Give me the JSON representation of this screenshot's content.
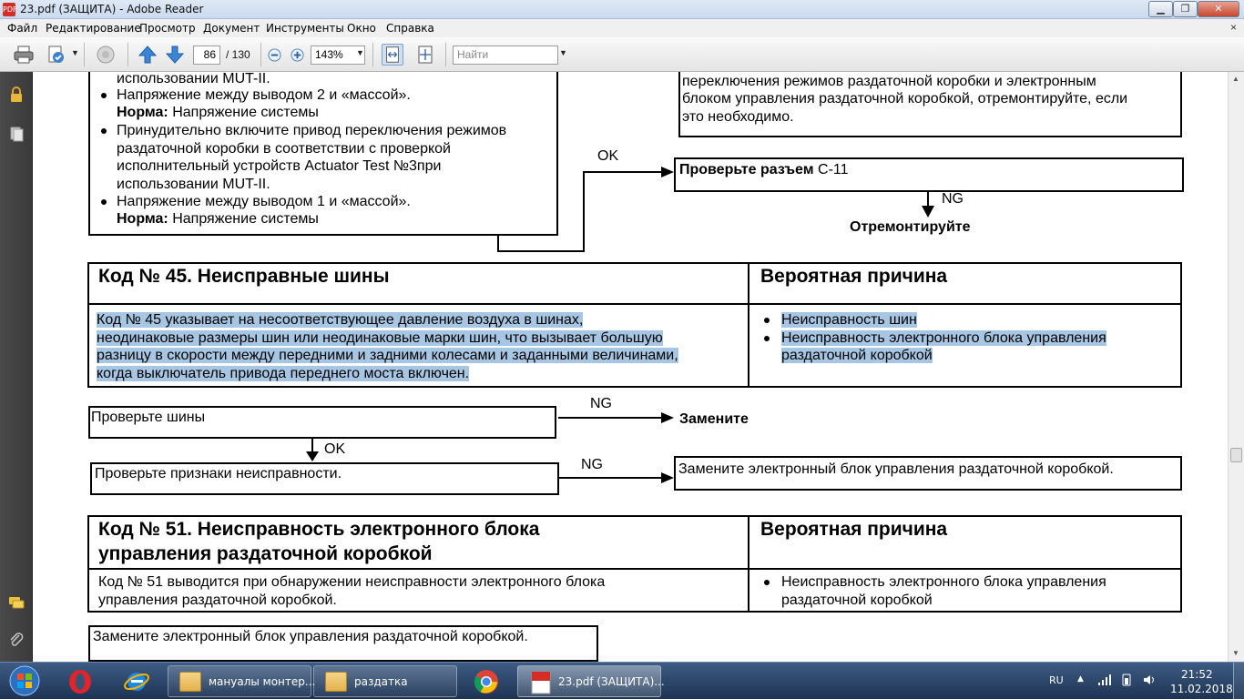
{
  "window": {
    "title": "23.pdf (ЗАЩИТА) - Adobe Reader",
    "app_icon_text": "PDF"
  },
  "menu": [
    "Файл",
    "Редактирование",
    "Просмотр",
    "Документ",
    "Инструменты",
    "Окно",
    "Справка"
  ],
  "menu_close": "×",
  "toolbar": {
    "page_current": "86",
    "page_total": "/ 130",
    "zoom": "143%",
    "find_placeholder": "Найти"
  },
  "document": {
    "top_left_box": {
      "line0": "использовании MUT-II.",
      "bullet1": "Напряжение между выводом 2 и «массой».",
      "norm1_label": "Норма:",
      "norm1_value": " Напряжение системы",
      "bullet2_l1": "Принудительно включите привод переключения режимов",
      "bullet2_l2": "раздаточной коробки в соответствии с проверкой",
      "bullet2_l3": "исполнительный устройств Actuator Test №3при",
      "bullet2_l4": "использовании MUT-II.",
      "bullet3": "Напряжение между выводом 1 и «массой».",
      "norm3_label": "Норма:",
      "norm3_value": " Напряжение системы"
    },
    "top_right_box": {
      "l1": "переключения режимов раздаточной коробки и электронным",
      "l2": "блоком управления раздаточной коробкой, отремонтируйте, если",
      "l3": "это необходимо."
    },
    "ok_label_1": "OK",
    "check_c11_bold": "Проверьте разъем ",
    "check_c11_rest": "С-11",
    "ng_label_1": "NG",
    "repair": "Отремонтируйте",
    "code45": {
      "title": "Код № 45. Неисправные шины",
      "cause_title": "Вероятная причина",
      "desc_l1": "Код № 45 указывает на несоответствующее давление воздуха в шинах,",
      "desc_l2": "неодинаковые размеры шин или неодинаковые марки шин, что вызывает большую",
      "desc_l3": "разницу в скорости между передними и задними колесами и заданными величинами,",
      "desc_l4": "когда выключатель привода переднего моста включен.",
      "cause1": "Неисправность шин",
      "cause2_l1": "Неисправность электронного блока управления",
      "cause2_l2": "раздаточной коробкой"
    },
    "check_tires": "Проверьте шины",
    "ng_label_2": "NG",
    "replace": "Замените",
    "ok_label_2": "OK",
    "check_symptoms": "Проверьте признаки неисправности.",
    "ng_label_3": "NG",
    "replace_ecu": "Замените электронный блок управления раздаточной коробкой.",
    "code51": {
      "title_l1": "Код № 51. Неисправность электронного блока",
      "title_l2": "управления раздаточной коробкой",
      "cause_title": "Вероятная причина",
      "desc_l1": "Код № 51 выводится при обнаружении неисправности электронного блока",
      "desc_l2": "управления раздаточной коробкой.",
      "cause_l1": "Неисправность электронного блока управления",
      "cause_l2": "раздаточной коробкой"
    },
    "replace_ecu_2": "Замените электронный блок управления раздаточной коробкой."
  },
  "taskbar": {
    "windows": [
      {
        "label": "мануалы монтер..."
      },
      {
        "label": "раздатка"
      },
      {
        "label": "23.pdf (ЗАЩИТА)..."
      }
    ],
    "language": "RU",
    "time": "21:52",
    "date": "11.02.2018"
  },
  "colors": {
    "selection": "#a6c6e3",
    "taskbar": "#2a4468",
    "close_button": "#c8452f"
  },
  "icons": [
    "print-icon",
    "tools-icon",
    "hand-icon",
    "prev-page-icon",
    "next-page-icon",
    "zoom-out-icon",
    "zoom-in-icon",
    "fit-width-icon",
    "fit-page-icon",
    "lock-icon",
    "pages-icon",
    "comments-icon",
    "attachment-icon",
    "opera-icon",
    "ie-icon",
    "chrome-icon",
    "folder-icon",
    "pdf-icon"
  ]
}
